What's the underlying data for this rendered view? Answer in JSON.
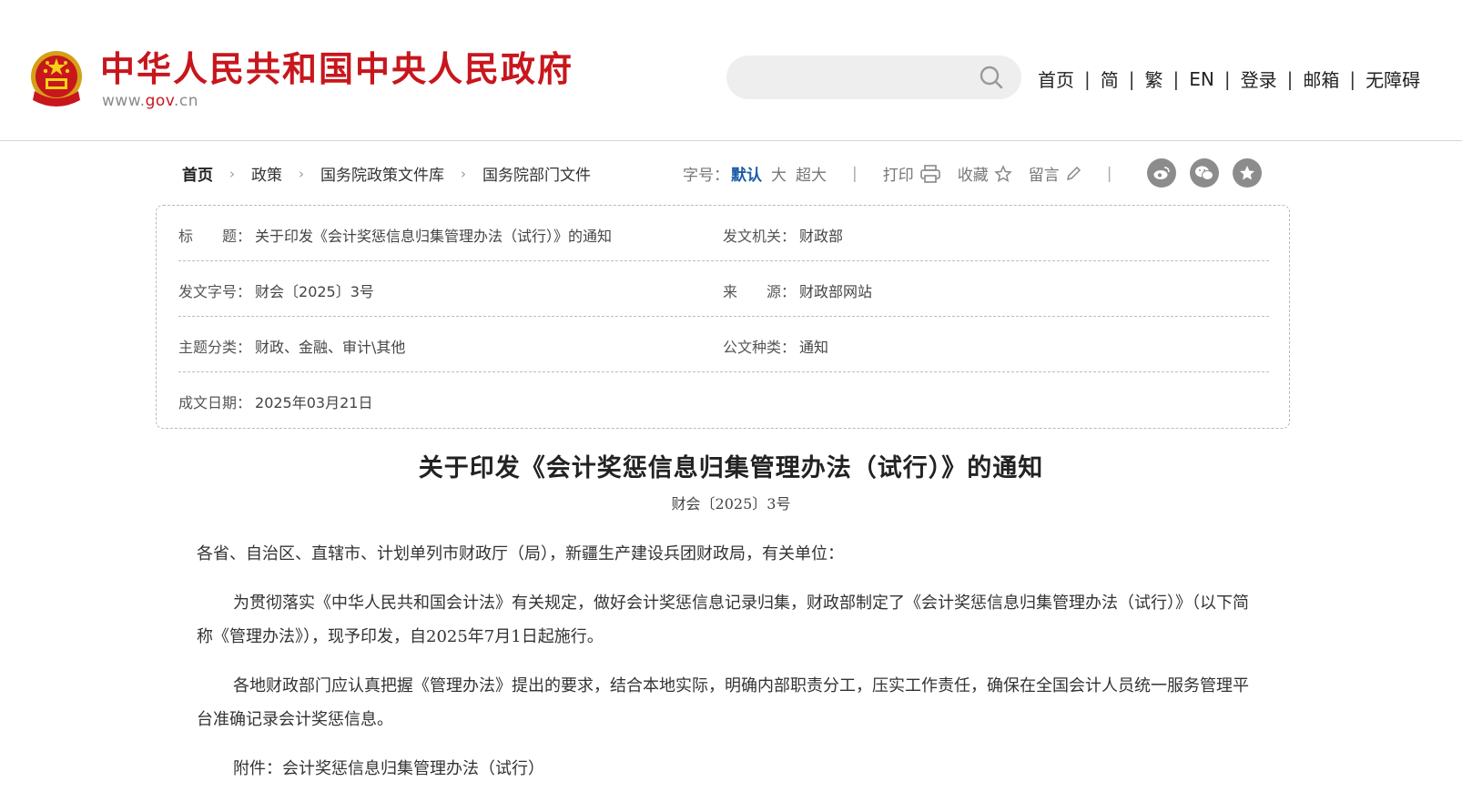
{
  "header": {
    "site_title": "中华人民共和国中央人民政府",
    "domain_prefix": "www.",
    "domain_gov": "gov",
    "domain_suffix": ".cn",
    "search_placeholder": "",
    "nav": [
      "首页",
      "简",
      "繁",
      "EN",
      "登录",
      "邮箱",
      "无障碍"
    ]
  },
  "breadcrumb": [
    "首页",
    "政策",
    "国务院政策文件库",
    "国务院部门文件"
  ],
  "tools": {
    "font_label": "字号：",
    "font_default": "默认",
    "font_large": "大",
    "font_xlarge": "超大",
    "print": "打印",
    "favorite": "收藏",
    "comment": "留言",
    "separator": "|"
  },
  "share_icons": [
    "weibo-icon",
    "wechat-icon",
    "star-circle-icon"
  ],
  "info": {
    "title_label": "标　　题：",
    "title_value": "关于印发《会计奖惩信息归集管理办法（试行）》的通知",
    "issuer_label": "发文机关：",
    "issuer_value": "财政部",
    "docno_label": "发文字号：",
    "docno_value": "财会〔2025〕3号",
    "source_label": "来　　源：",
    "source_value": "财政部网站",
    "topic_label": "主题分类：",
    "topic_value": "财政、金融、审计\\其他",
    "type_label": "公文种类：",
    "type_value": "通知",
    "date_label": "成文日期：",
    "date_value": "2025年03月21日"
  },
  "article": {
    "title": "关于印发《会计奖惩信息归集管理办法（试行）》的通知",
    "doc_no": "财会〔2025〕3号",
    "addressee": "各省、自治区、直辖市、计划单列市财政厅（局），新疆生产建设兵团财政局，有关单位：",
    "para1": "为贯彻落实《中华人民共和国会计法》有关规定，做好会计奖惩信息记录归集，财政部制定了《会计奖惩信息归集管理办法（试行）》（以下简称《管理办法》），现予印发，自2025年7月1日起施行。",
    "para2": "各地财政部门应认真把握《管理办法》提出的要求，结合本地实际，明确内部职责分工，压实工作责任，确保在全国会计人员统一服务管理平台准确记录会计奖惩信息。",
    "attachment": "附件：会计奖惩信息归集管理办法（试行）"
  },
  "colors": {
    "brand_red": "#c8161d",
    "link_blue": "#1a5aa8",
    "icon_grey": "#8c8c8c"
  }
}
